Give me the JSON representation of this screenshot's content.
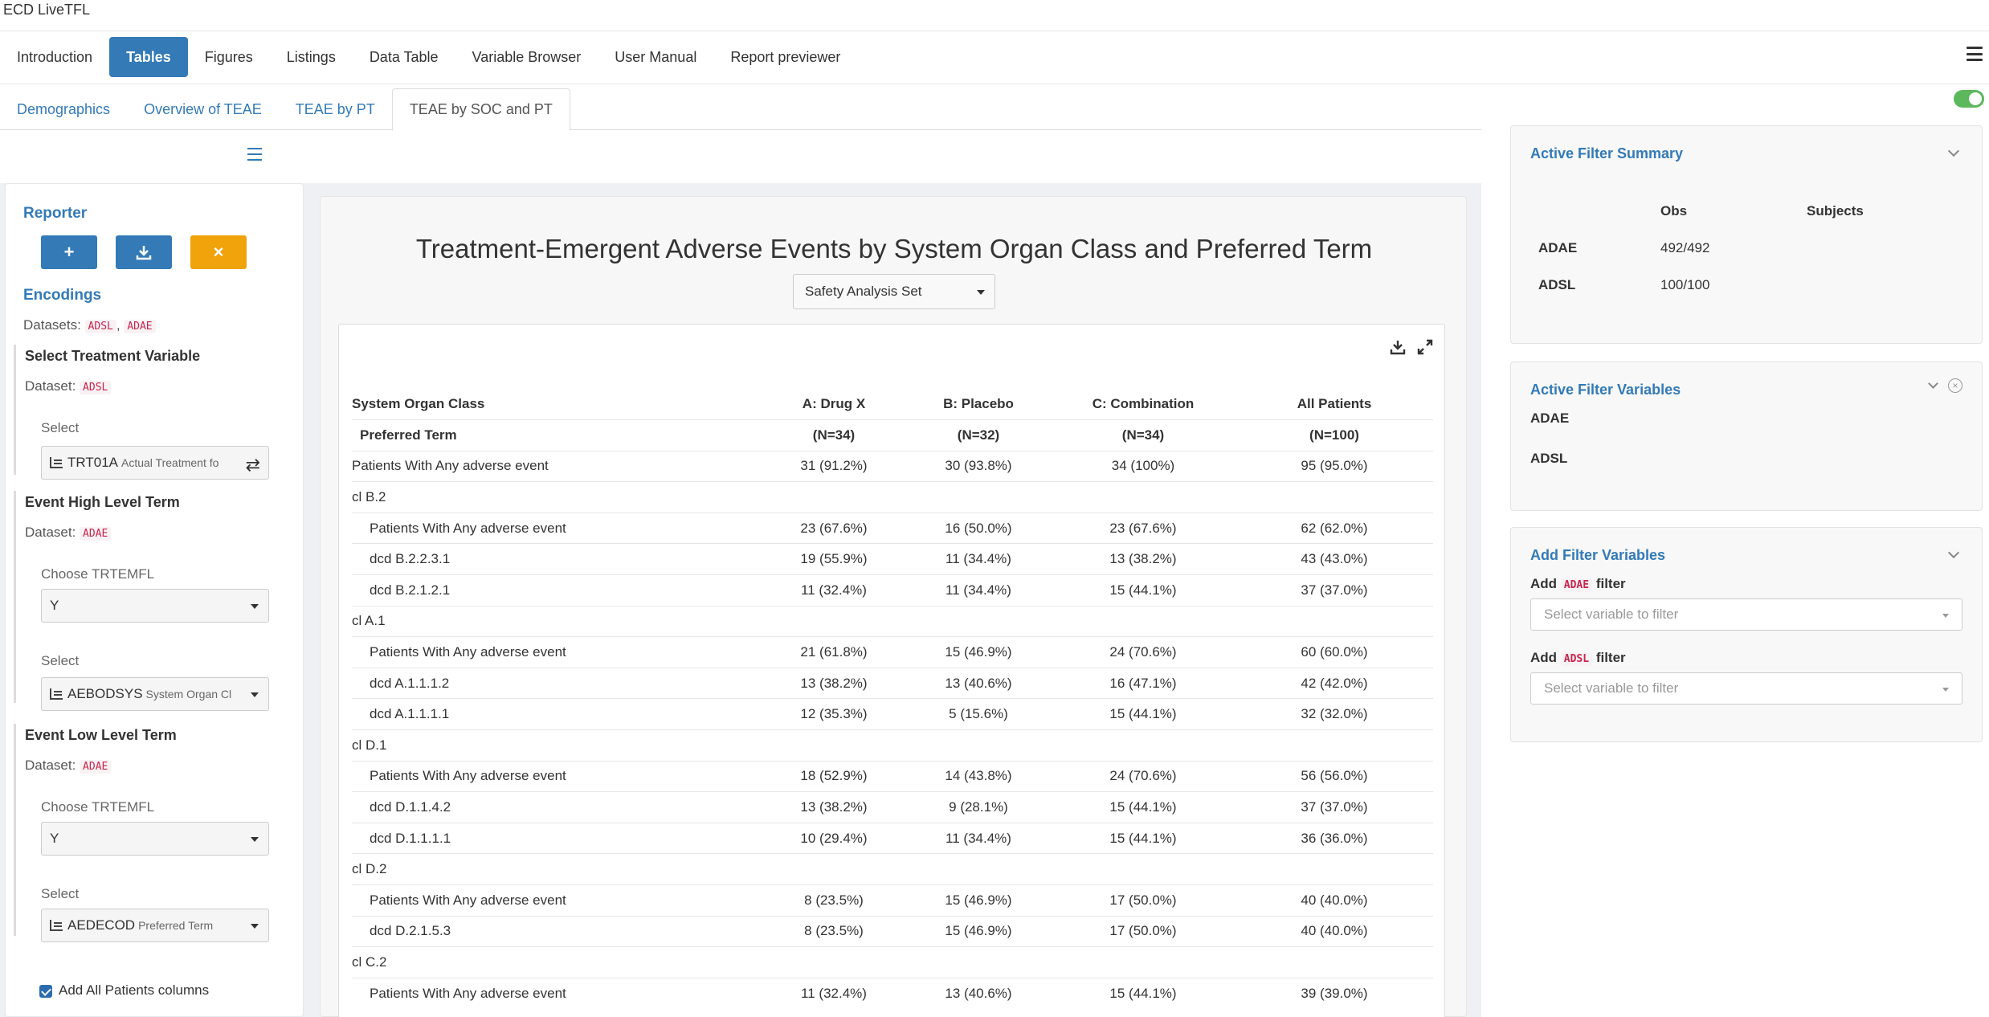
{
  "app": {
    "title": "ECD LiveTFL"
  },
  "main_nav": {
    "items": [
      {
        "label": "Introduction",
        "active": false
      },
      {
        "label": "Tables",
        "active": true
      },
      {
        "label": "Figures",
        "active": false
      },
      {
        "label": "Listings",
        "active": false
      },
      {
        "label": "Data Table",
        "active": false
      },
      {
        "label": "Variable Browser",
        "active": false
      },
      {
        "label": "User Manual",
        "active": false
      },
      {
        "label": "Report previewer",
        "active": false
      }
    ]
  },
  "sub_tabs": {
    "items": [
      {
        "label": "Demographics",
        "active": false
      },
      {
        "label": "Overview of TEAE",
        "active": false
      },
      {
        "label": "TEAE by PT",
        "active": false
      },
      {
        "label": "TEAE by SOC and PT",
        "active": true
      }
    ]
  },
  "encodings": {
    "reporter_heading": "Reporter",
    "add_icon": "+",
    "download_icon": "download-icon",
    "reset_icon": "×",
    "encodings_heading": "Encodings",
    "datasets_label": "Datasets:",
    "datasets": [
      "ADSL",
      "ADAE"
    ],
    "datasets_sep": ", ",
    "dataset_label": "Dataset:",
    "treatment": {
      "title": "Select Treatment Variable",
      "dataset": "ADSL",
      "select_label": "Select",
      "value": "TRT01A",
      "value_desc": "Actual Treatment fo"
    },
    "high_level": {
      "title": "Event High Level Term",
      "dataset": "ADAE",
      "choose_label": "Choose TRTEMFL",
      "choose_value": "Y",
      "select_label": "Select",
      "value": "AEBODSYS",
      "value_desc": "System Organ Cl"
    },
    "low_level": {
      "title": "Event Low Level Term",
      "dataset": "ADAE",
      "choose_label": "Choose TRTEMFL",
      "choose_value": "Y",
      "select_label": "Select",
      "value": "AEDECOD",
      "value_desc": "Preferred Term"
    },
    "all_patients_checkbox": {
      "label": "Add All Patients columns",
      "checked": true
    }
  },
  "output": {
    "title": "Treatment-Emergent Adverse Events by System Organ Class and Preferred Term",
    "population_select": "Safety Analysis Set",
    "table": {
      "header": {
        "col0": "System Organ Class",
        "col0_sub": "Preferred Term",
        "columns": [
          {
            "name": "A: Drug X",
            "n": "(N=34)"
          },
          {
            "name": "B: Placebo",
            "n": "(N=32)"
          },
          {
            "name": "C: Combination",
            "n": "(N=34)"
          },
          {
            "name": "All Patients",
            "n": "(N=100)"
          }
        ]
      },
      "rows": [
        {
          "label": "Patients With Any adverse event",
          "indent": false,
          "values": [
            "31 (91.2%)",
            "30 (93.8%)",
            "34 (100%)",
            "95 (95.0%)"
          ]
        },
        {
          "label": "cl B.2",
          "indent": false,
          "values": [
            "",
            "",
            "",
            ""
          ]
        },
        {
          "label": "Patients With Any adverse event",
          "indent": true,
          "values": [
            "23 (67.6%)",
            "16 (50.0%)",
            "23 (67.6%)",
            "62 (62.0%)"
          ]
        },
        {
          "label": "dcd B.2.2.3.1",
          "indent": true,
          "values": [
            "19 (55.9%)",
            "11 (34.4%)",
            "13 (38.2%)",
            "43 (43.0%)"
          ]
        },
        {
          "label": "dcd B.2.1.2.1",
          "indent": true,
          "values": [
            "11 (32.4%)",
            "11 (34.4%)",
            "15 (44.1%)",
            "37 (37.0%)"
          ]
        },
        {
          "label": "cl A.1",
          "indent": false,
          "values": [
            "",
            "",
            "",
            ""
          ]
        },
        {
          "label": "Patients With Any adverse event",
          "indent": true,
          "values": [
            "21 (61.8%)",
            "15 (46.9%)",
            "24 (70.6%)",
            "60 (60.0%)"
          ]
        },
        {
          "label": "dcd A.1.1.1.2",
          "indent": true,
          "values": [
            "13 (38.2%)",
            "13 (40.6%)",
            "16 (47.1%)",
            "42 (42.0%)"
          ]
        },
        {
          "label": "dcd A.1.1.1.1",
          "indent": true,
          "values": [
            "12 (35.3%)",
            "5 (15.6%)",
            "15 (44.1%)",
            "32 (32.0%)"
          ]
        },
        {
          "label": "cl D.1",
          "indent": false,
          "values": [
            "",
            "",
            "",
            ""
          ]
        },
        {
          "label": "Patients With Any adverse event",
          "indent": true,
          "values": [
            "18 (52.9%)",
            "14 (43.8%)",
            "24 (70.6%)",
            "56 (56.0%)"
          ]
        },
        {
          "label": "dcd D.1.1.4.2",
          "indent": true,
          "values": [
            "13 (38.2%)",
            "9 (28.1%)",
            "15 (44.1%)",
            "37 (37.0%)"
          ]
        },
        {
          "label": "dcd D.1.1.1.1",
          "indent": true,
          "values": [
            "10 (29.4%)",
            "11 (34.4%)",
            "15 (44.1%)",
            "36 (36.0%)"
          ]
        },
        {
          "label": "cl D.2",
          "indent": false,
          "values": [
            "",
            "",
            "",
            ""
          ]
        },
        {
          "label": "Patients With Any adverse event",
          "indent": true,
          "values": [
            "8 (23.5%)",
            "15 (46.9%)",
            "17 (50.0%)",
            "40 (40.0%)"
          ]
        },
        {
          "label": "dcd D.2.1.5.3",
          "indent": true,
          "values": [
            "8 (23.5%)",
            "15 (46.9%)",
            "17 (50.0%)",
            "40 (40.0%)"
          ]
        },
        {
          "label": "cl C.2",
          "indent": false,
          "values": [
            "",
            "",
            "",
            ""
          ]
        },
        {
          "label": "Patients With Any adverse event",
          "indent": true,
          "values": [
            "11 (32.4%)",
            "13 (40.6%)",
            "15 (44.1%)",
            "39 (39.0%)"
          ]
        }
      ]
    }
  },
  "filter_summary": {
    "title": "Active Filter Summary",
    "col_obs": "Obs",
    "col_subjects": "Subjects",
    "rows": [
      {
        "dataset": "ADAE",
        "obs": "492/492",
        "subjects": ""
      },
      {
        "dataset": "ADSL",
        "obs": "100/100",
        "subjects": ""
      }
    ]
  },
  "active_filter_vars": {
    "title": "Active Filter Variables",
    "datasets": [
      "ADAE",
      "ADSL"
    ]
  },
  "add_filter_vars": {
    "title": "Add Filter Variables",
    "add_word": "Add",
    "filter_word": "filter",
    "adae_tag": "ADAE",
    "adsl_tag": "ADSL",
    "placeholder": "Select variable to filter"
  }
}
